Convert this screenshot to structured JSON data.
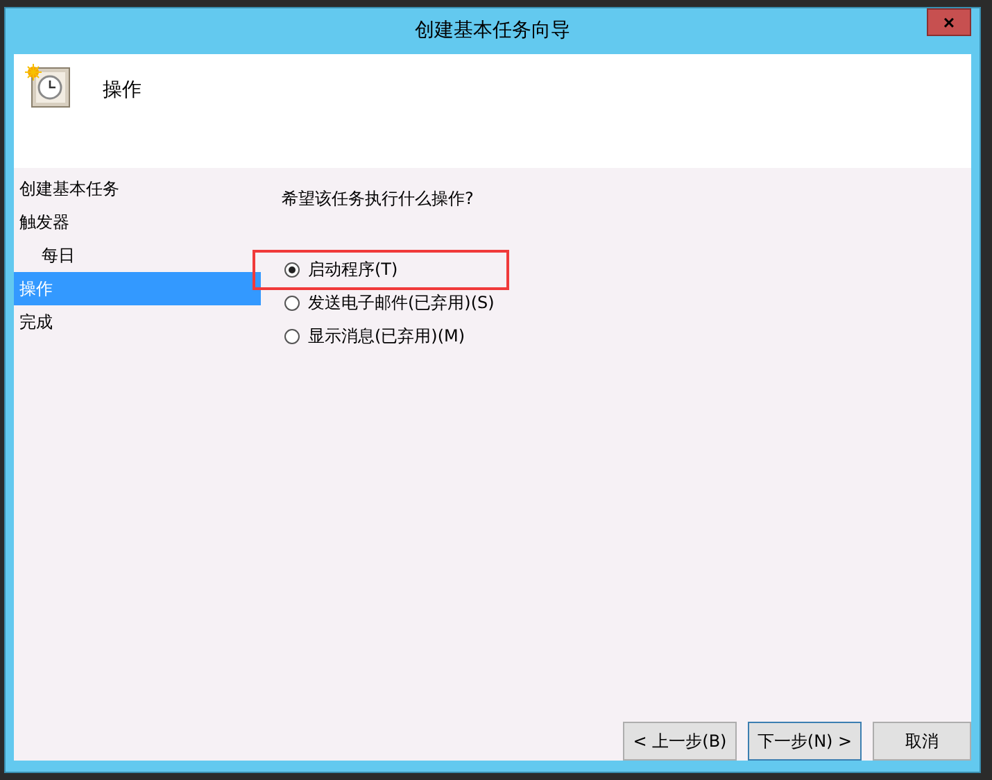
{
  "window": {
    "title": "创建基本任务向导",
    "close": "×"
  },
  "header": {
    "title": "操作"
  },
  "sidebar": {
    "items": [
      {
        "label": "创建基本任务",
        "selected": false
      },
      {
        "label": "触发器",
        "selected": false,
        "children": [
          {
            "label": "每日",
            "selected": false
          }
        ]
      },
      {
        "label": "操作",
        "selected": true
      },
      {
        "label": "完成",
        "selected": false
      }
    ]
  },
  "question": "希望该任务执行什么操作?",
  "options": [
    {
      "label": "启动程序(T)",
      "selected": true,
      "highlighted": true
    },
    {
      "label": "发送电子邮件(已弃用)(S)",
      "selected": false,
      "highlighted": false
    },
    {
      "label": "显示消息(已弃用)(M)",
      "selected": false,
      "highlighted": false
    }
  ],
  "buttons": [
    {
      "label": "< 上一步(B)",
      "default": false
    },
    {
      "label": "下一步(N) >",
      "default": true
    },
    {
      "label": "取消",
      "default": false
    }
  ]
}
